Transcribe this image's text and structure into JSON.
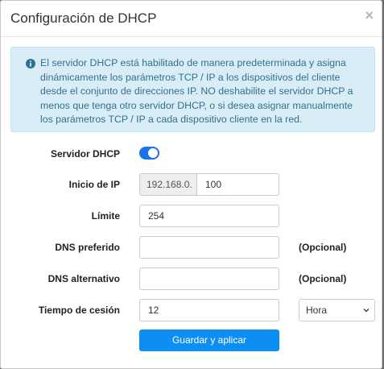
{
  "modal": {
    "title": "Configuración de DHCP",
    "close_glyph": "×"
  },
  "alert": {
    "icon": "info-circle-icon",
    "text": "El servidor DHCP está habilitado de manera predeterminada y asigna dinámicamente los parámetros TCP / IP a los dispositivos del cliente desde el conjunto de direcciones IP. NO deshabilite el servidor DHCP a menos que tenga otro servidor DHCP, o si desea asignar manualmente los parámetros TCP / IP a cada dispositivo cliente en la red."
  },
  "form": {
    "dhcp_server": {
      "label": "Servidor DHCP",
      "enabled": true
    },
    "ip_start": {
      "label": "Inicio de IP",
      "prefix": "192.168.0.",
      "value": "100"
    },
    "limit": {
      "label": "Límite",
      "value": "254"
    },
    "dns_preferred": {
      "label": "DNS preferido",
      "value": "",
      "hint": "(Opcional)"
    },
    "dns_alternate": {
      "label": "DNS alternativo",
      "value": "",
      "hint": "(Opcional)"
    },
    "lease_time": {
      "label": "Tiempo de cesión",
      "value": "12",
      "unit_selected": "Hora"
    },
    "submit_label": "Guardar y aplicar"
  },
  "colors": {
    "toggle_on": "#1a73e8",
    "primary_button": "#0d8ef2",
    "alert_bg": "#d9edf7",
    "alert_text": "#31708f"
  }
}
